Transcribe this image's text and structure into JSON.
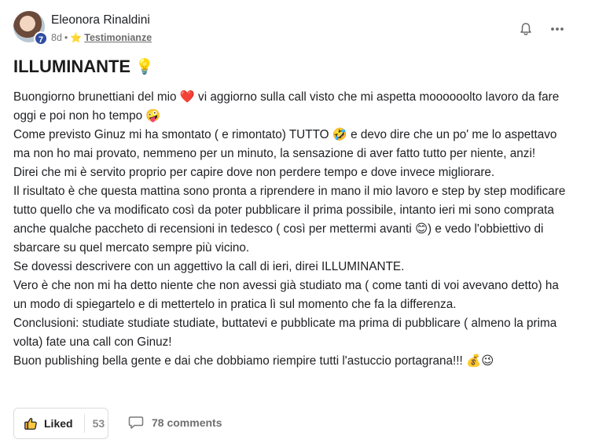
{
  "author": {
    "name": "Eleonora Rinaldini",
    "level": "7"
  },
  "meta": {
    "time": "8d",
    "separator": "•",
    "category_icon": "star-icon",
    "category": "Testimonianze"
  },
  "title": {
    "text": "ILLUMINANTE",
    "emoji": "💡"
  },
  "body_lines": [
    "Buongiorno brunettiani del mio ❤️ vi aggiorno sulla call visto che mi aspetta moooooolto lavoro da fare oggi e poi non ho tempo 🤪",
    "Come previsto Ginuz mi ha smontato ( e rimontato) TUTTO 🤣 e devo dire che un po' me lo aspettavo ma non ho mai provato, nemmeno per un minuto, la sensazione di aver fatto tutto per niente, anzi!",
    "Direi che mi è servito proprio per capire dove non perdere tempo e dove invece migliorare.",
    "Il risultato è che questa mattina sono pronta a riprendere in mano il mio lavoro e step by step modificare tutto quello che va modificato così da poter pubblicare il prima possibile, intanto ieri mi sono comprata anche qualche paccheto di recensioni in tedesco ( così per mettermi avanti 😊) e vedo l'obbiettivo di sbarcare su quel mercato sempre più vicino.",
    "Se dovessi descrivere con un aggettivo la call di ieri, direi ILLUMINANTE.",
    "Vero è che non mi ha detto niente che non avessi già studiato ma ( come tanti di voi avevano detto) ha un modo di spiegartelo e di mettertelo in pratica lì sul momento che fa la differenza.",
    "Conclusioni: studiate studiate studiate, buttatevi e pubblicate ma prima di pubblicare ( almeno la prima volta) fate una call con Ginuz!",
    "Buon publishing bella gente e dai che dobbiamo riempire tutti l'astuccio portagrana!!! 💰😉"
  ],
  "footer": {
    "like_label": "Liked",
    "like_count": "53",
    "comments_label": "78 comments"
  },
  "colors": {
    "level_badge": "#2f4da3",
    "text": "#202124",
    "muted": "#7a7a7a"
  }
}
